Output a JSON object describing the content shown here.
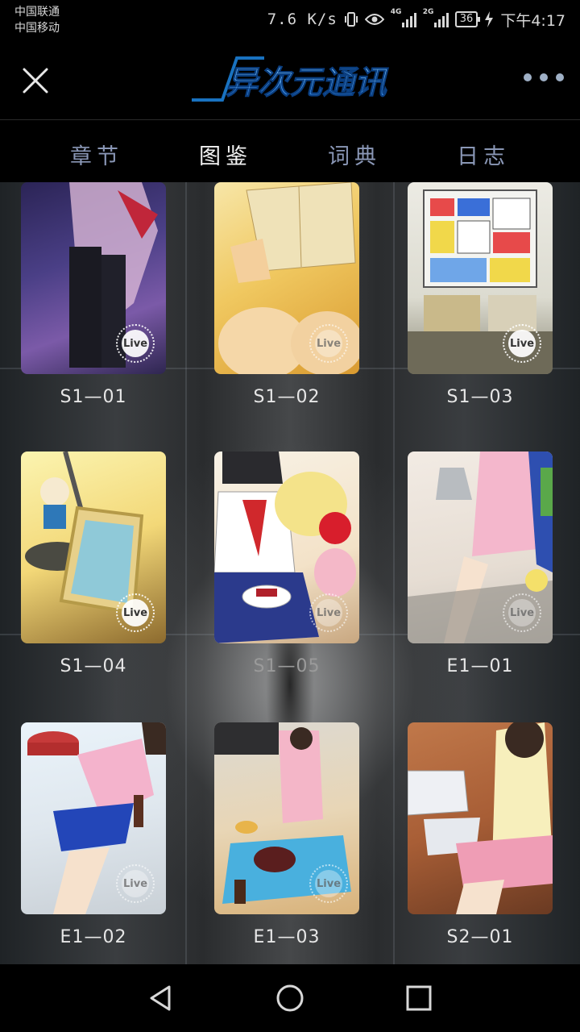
{
  "status_bar": {
    "carrier_1": "中国联通",
    "carrier_2": "中国移动",
    "net_speed": "7.6 K/s",
    "sig1_label": "4G",
    "sig2_label": "2G",
    "battery": "36",
    "time": "下午4:17"
  },
  "header": {
    "logo_text": "异次元通讯"
  },
  "tabs": [
    {
      "label": "章节",
      "active": false
    },
    {
      "label": "图鉴",
      "active": true
    },
    {
      "label": "词典",
      "active": false
    },
    {
      "label": "日志",
      "active": false
    }
  ],
  "gallery": {
    "badge_label": "Live",
    "items": [
      {
        "id": "S1—01"
      },
      {
        "id": "S1—02"
      },
      {
        "id": "S1—03"
      },
      {
        "id": "S1—04"
      },
      {
        "id": "S1—05"
      },
      {
        "id": "E1—01"
      },
      {
        "id": "E1—02"
      },
      {
        "id": "E1—03"
      },
      {
        "id": "S2—01"
      }
    ]
  },
  "colors": {
    "tab_inactive": "#8a97b6",
    "tab_active": "#f2f2f2",
    "logo_blue": "#1f8ff0"
  }
}
